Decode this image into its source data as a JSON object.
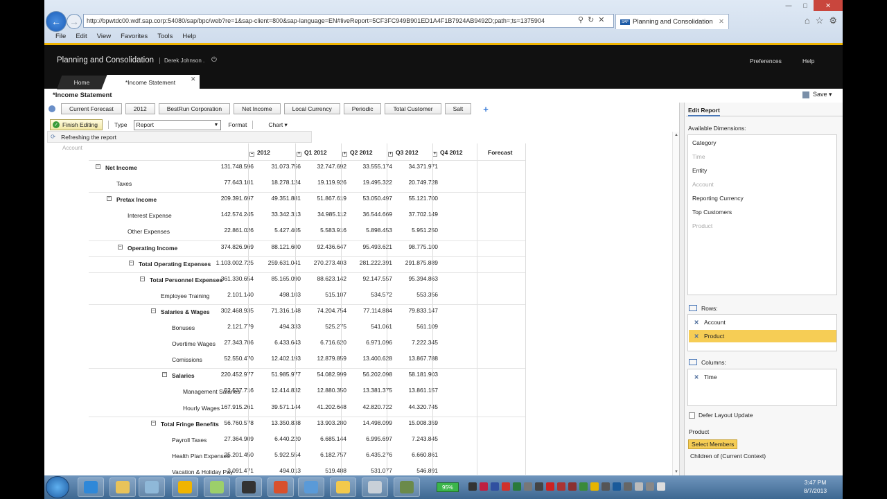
{
  "browser": {
    "url": "http://bpwtdc00.wdf.sap.corp:54080/sap/bpc/web?re=1&sap-client=800&sap-language=EN#liveReport=5CF3FC949B901ED1A4F1B7924AB9492D;path=;ts=1375904",
    "tab_title": "Planning and Consolidation",
    "menu": [
      "File",
      "Edit",
      "View",
      "Favorites",
      "Tools",
      "Help"
    ]
  },
  "app": {
    "title": "Planning and Consolidation",
    "user": "Derek Johnson .",
    "preferences": "Preferences",
    "help": "Help",
    "tabs": {
      "home": "Home",
      "income": "*Income Statement"
    }
  },
  "report": {
    "title": "*Income Statement",
    "save": "Save",
    "context": [
      "Current Forecast",
      "2012",
      "BestRun Corporation",
      "Net Income",
      "Local Currency",
      "Periodic",
      "Total Customer",
      "Salt"
    ],
    "finish_editing": "Finish Editing",
    "type_label": "Type",
    "type_value": "Report",
    "format": "Format",
    "chart": "Chart",
    "refreshing": "Refreshing the report",
    "account_header": "Account",
    "columns": [
      "2012",
      "Q1 2012",
      "Q2 2012",
      "Q3 2012",
      "Q4 2012",
      "Forecast"
    ],
    "rows": [
      {
        "label": "Net Income",
        "values": [
          "131.748.596",
          "31.073.756",
          "32.747.692",
          "33.555.174",
          "34.371.971"
        ]
      },
      {
        "label": "Taxes",
        "values": [
          "77.643.101",
          "18.278.124",
          "19.119.926",
          "19.495.322",
          "20.749.728"
        ]
      },
      {
        "label": "Pretax Income",
        "values": [
          "209.391.697",
          "49.351.881",
          "51.867.619",
          "53.050.497",
          "55.121.700"
        ]
      },
      {
        "label": "Interest Expense",
        "values": [
          "142.574.245",
          "33.342.313",
          "34.985.112",
          "36.544.669",
          "37.702.149"
        ]
      },
      {
        "label": "Other Expenses",
        "values": [
          "22.861.026",
          "5.427.405",
          "5.583.916",
          "5.898.453",
          "5.951.250"
        ]
      },
      {
        "label": "Operating Income",
        "values": [
          "374.826.969",
          "88.121.600",
          "92.436.647",
          "95.493.621",
          "98.775.100"
        ]
      },
      {
        "label": "Total Operating Expenses",
        "values": [
          "1.103.002.725",
          "259.631.041",
          "270.273.403",
          "281.222.391",
          "291.875.889"
        ]
      },
      {
        "label": "Total Personnel Expenses",
        "values": [
          "361.330.654",
          "85.165.090",
          "88.623.142",
          "92.147.557",
          "95.394.863"
        ]
      },
      {
        "label": "Employee Training",
        "values": [
          "2.101.140",
          "498.103",
          "515.107",
          "534.572",
          "553.356"
        ]
      },
      {
        "label": "Salaries & Wages",
        "values": [
          "302.468.935",
          "71.316.148",
          "74.204.754",
          "77.114.884",
          "79.833.147"
        ]
      },
      {
        "label": "Bonuses",
        "values": [
          "2.121.779",
          "494.333",
          "525.275",
          "541.061",
          "561.109"
        ]
      },
      {
        "label": "Overtime Wages",
        "values": [
          "27.343.706",
          "6.433.643",
          "6.716.620",
          "6.971.096",
          "7.222.345"
        ]
      },
      {
        "label": "Comissions",
        "values": [
          "52.550.470",
          "12.402.193",
          "12.879.859",
          "13.400.628",
          "13.867.788"
        ]
      },
      {
        "label": "Salaries",
        "values": [
          "220.452.977",
          "51.985.977",
          "54.082.999",
          "56.202.098",
          "58.181.903"
        ]
      },
      {
        "label": "Management Salaries",
        "values": [
          "52.537.716",
          "12.414.832",
          "12.880.350",
          "13.381.375",
          "13.861.157"
        ]
      },
      {
        "label": "Hourly Wages",
        "values": [
          "167.915.261",
          "39.571.144",
          "41.202.648",
          "42.820.722",
          "44.320.745"
        ]
      },
      {
        "label": "Total Fringe Benefits",
        "values": [
          "56.760.578",
          "13.350.838",
          "13.903.280",
          "14.498.099",
          "15.008.359"
        ]
      },
      {
        "label": "Payroll Taxes",
        "values": [
          "27.364.909",
          "6.440.220",
          "6.685.144",
          "6.995.697",
          "7.243.845"
        ]
      },
      {
        "label": "Health Plan Expenses",
        "values": [
          "25.201.450",
          "5.922.554",
          "6.182.757",
          "6.435.276",
          "6.660.861"
        ]
      },
      {
        "label": "Vacation & Holiday Pay",
        "values": [
          "2.091.471",
          "494.013",
          "519.488",
          "531.077",
          "546.891"
        ]
      }
    ]
  },
  "edit_panel": {
    "title": "Edit Report",
    "available_label": "Available Dimensions:",
    "dimensions": [
      "Category",
      "Time",
      "Entity",
      "Account",
      "Reporting Currency",
      "Top Customers",
      "Product"
    ],
    "rows_label": "Rows:",
    "rows_items": [
      "Account",
      "Product"
    ],
    "columns_label": "Columns:",
    "columns_items": [
      "Time"
    ],
    "defer_label": "Defer Layout Update",
    "product_label": "Product",
    "select_members": "Select Members",
    "children_context": "Children of (Current Context)"
  },
  "taskbar": {
    "battery": "95%",
    "time": "3:47 PM",
    "date": "8/7/2013"
  }
}
